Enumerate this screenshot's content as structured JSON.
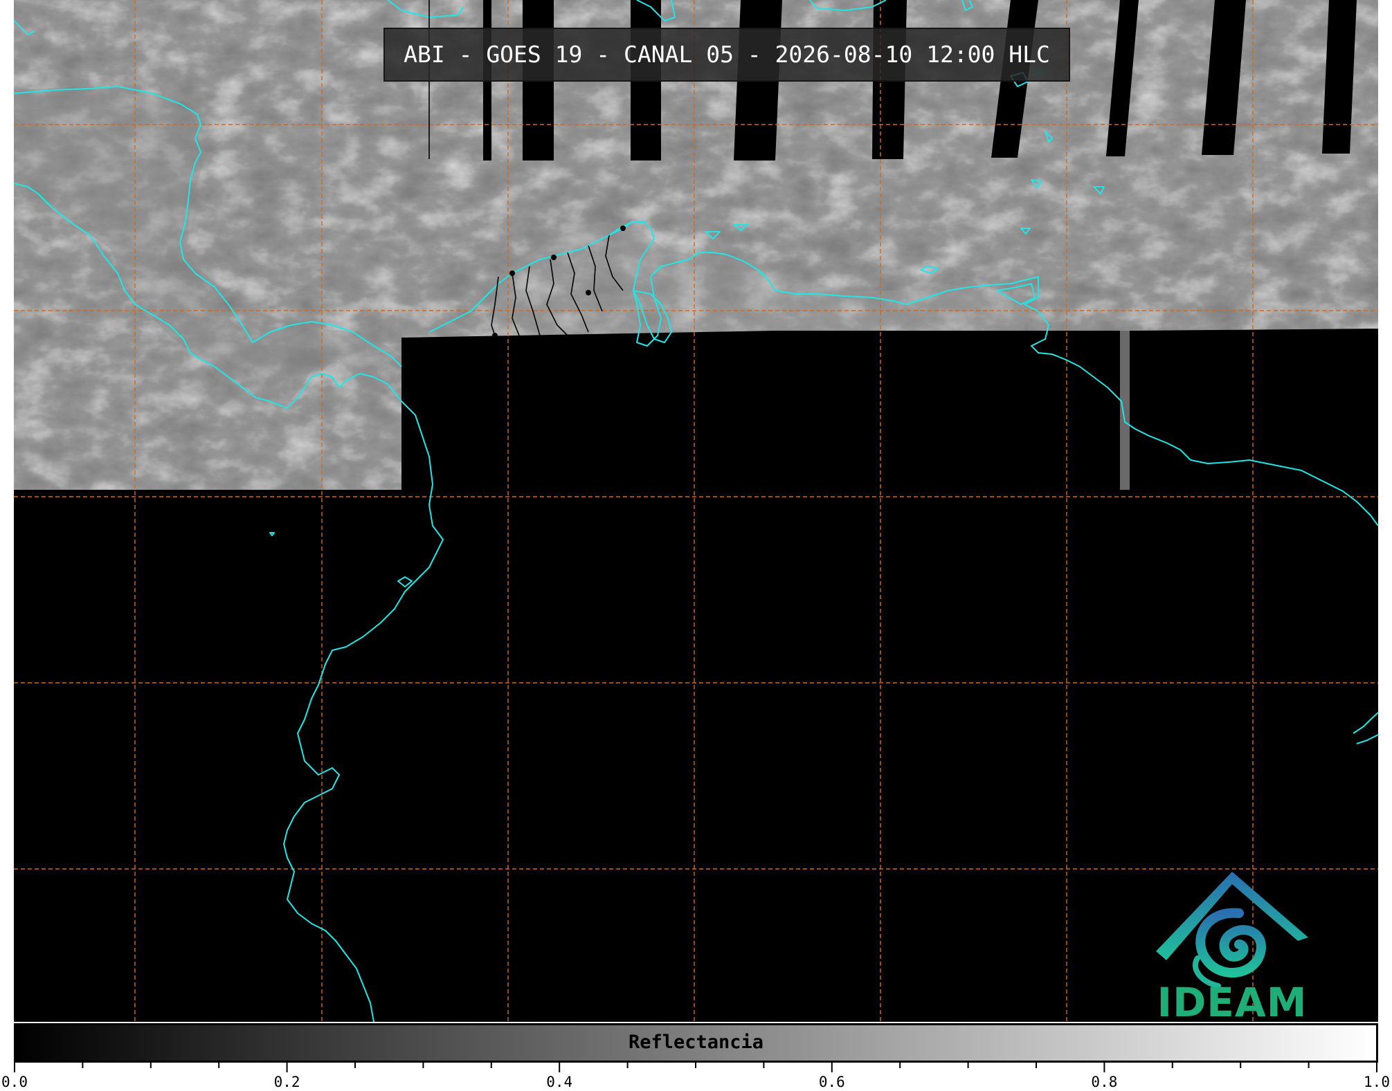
{
  "title": "ABI - GOES 19 - CANAL 05 - 2026-08-10 12:00 HLC",
  "colorbar": {
    "label": "Reflectancia",
    "min": 0.0,
    "max": 1.0,
    "major_ticks": [
      {
        "value": 0.0,
        "label": "0.0"
      },
      {
        "value": 0.2,
        "label": "0.2"
      },
      {
        "value": 0.4,
        "label": "0.4"
      },
      {
        "value": 0.6,
        "label": "0.6"
      },
      {
        "value": 0.8,
        "label": "0.8"
      },
      {
        "value": 1.0,
        "label": "1.0"
      }
    ],
    "minor_tick_step": 0.05,
    "colormap": [
      "#000000",
      "#ffffff"
    ]
  },
  "logo": {
    "text": "IDEAM",
    "text_color": "#1fae78",
    "gradient": [
      "#2a6fb0",
      "#20c09a"
    ]
  },
  "colors": {
    "coastline": "#22e5e5",
    "borders": "#000000",
    "gridlines": "#d2691e",
    "no_data": "#000000"
  },
  "icons": {
    "logo": "ideam-mountain-spiral-icon"
  }
}
